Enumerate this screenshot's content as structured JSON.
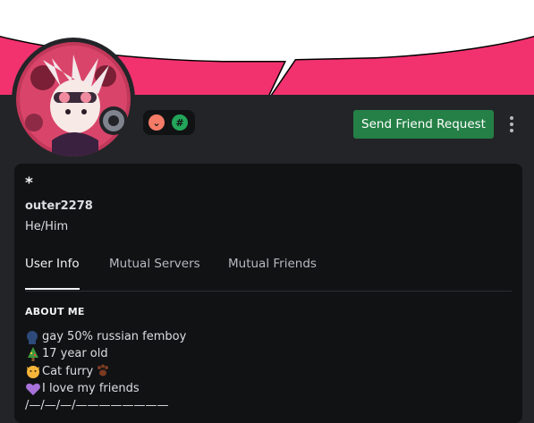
{
  "profile": {
    "display_name": "*",
    "username": "outer2278",
    "pronouns": "He/Him",
    "status": "offline"
  },
  "header": {
    "banner_color": "#f2326f",
    "send_friend_request_label": "Send Friend Request",
    "badges": [
      {
        "icon": "nitro-badge-icon",
        "glyph": "⌄"
      },
      {
        "icon": "hashtag-badge-icon",
        "glyph": "#"
      }
    ]
  },
  "tabs": [
    {
      "label": "User Info",
      "active": true
    },
    {
      "label": "Mutual Servers",
      "active": false
    },
    {
      "label": "Mutual Friends",
      "active": false
    }
  ],
  "about": {
    "title": "ABOUT ME",
    "lines": [
      {
        "emoji": "speaking-head-icon",
        "text": "gay 50% russian femboy"
      },
      {
        "emoji": "christmas-tree-icon",
        "text": "17 year old"
      },
      {
        "emoji": "cat-face-icon",
        "text": "Cat furry"
      },
      {
        "emoji": "purple-heart-icon",
        "text": "I love my friends"
      },
      {
        "emoji": "",
        "text": "/—/—/—/————————"
      }
    ],
    "trailing_emoji": "paw-prints-icon"
  },
  "colors": {
    "accent": "#f2326f",
    "button": "#248046",
    "card_bg": "#111214",
    "page_bg": "#232428"
  }
}
